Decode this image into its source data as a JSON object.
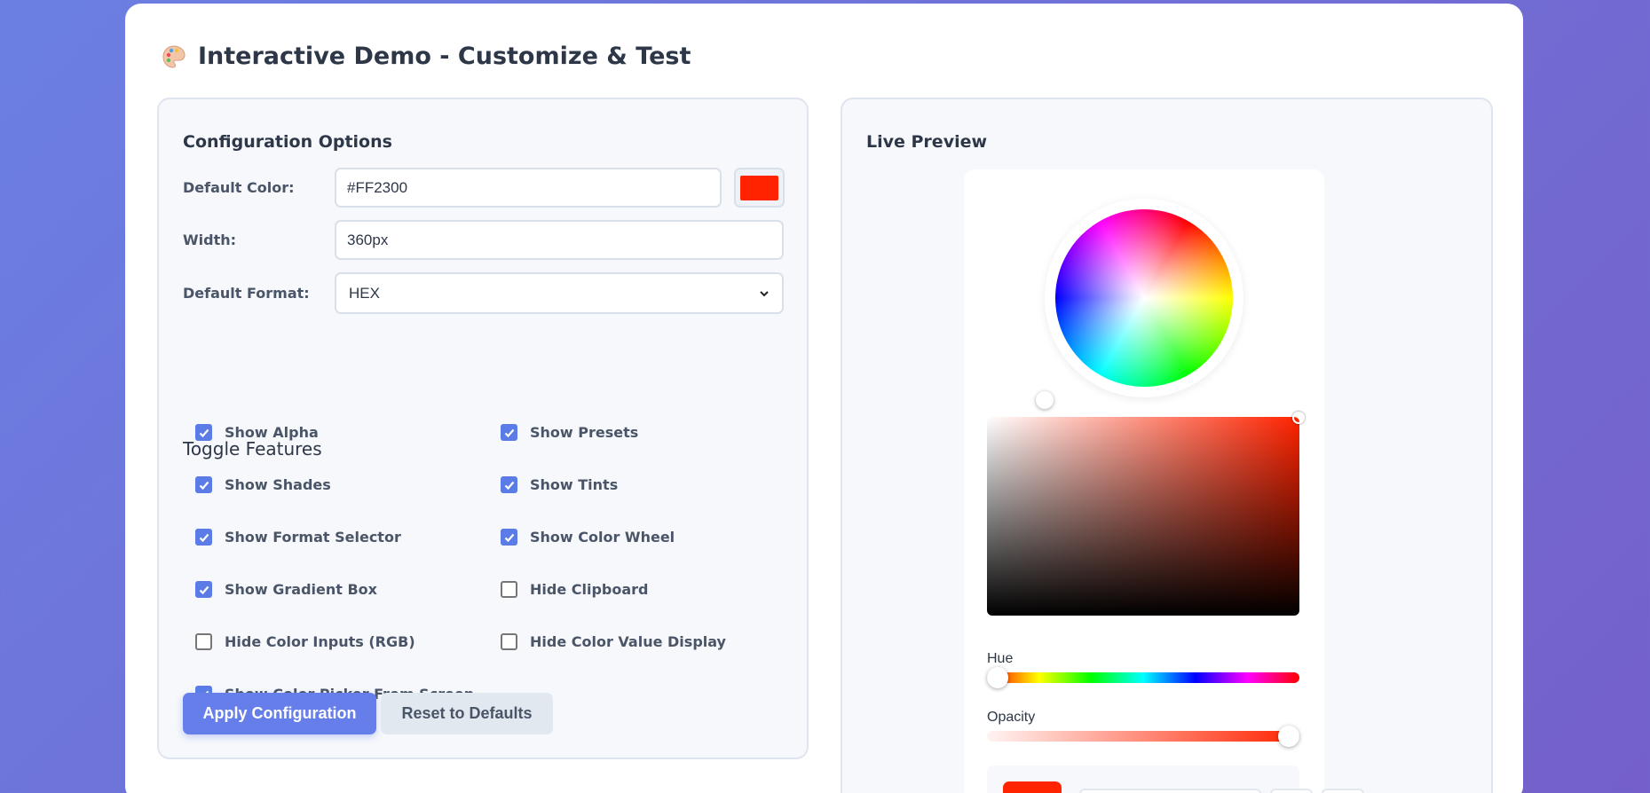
{
  "page": {
    "title": "Interactive Demo - Customize & Test",
    "title_icon": "palette-icon"
  },
  "config": {
    "heading": "Configuration Options",
    "default_color_label": "Default Color:",
    "default_color_value": "#FF2300",
    "width_label": "Width:",
    "width_value": "360px",
    "format_label": "Default Format:",
    "format_value": "HEX",
    "toggle_heading": "Toggle Features",
    "toggles": [
      {
        "label": "Show Alpha",
        "checked": true
      },
      {
        "label": "Show Presets",
        "checked": true
      },
      {
        "label": "Show Shades",
        "checked": true
      },
      {
        "label": "Show Tints",
        "checked": true
      },
      {
        "label": "Show Format Selector",
        "checked": true
      },
      {
        "label": "Show Color Wheel",
        "checked": true
      },
      {
        "label": "Show Gradient Box",
        "checked": true
      },
      {
        "label": "Hide Clipboard",
        "checked": false
      },
      {
        "label": "Hide Color Inputs (RGB)",
        "checked": false
      },
      {
        "label": "Hide Color Value Display",
        "checked": false
      },
      {
        "label": "Show Color Picker From Screen",
        "checked": true
      }
    ],
    "apply_label": "Apply Configuration",
    "reset_label": "Reset to Defaults"
  },
  "preview": {
    "heading": "Live Preview",
    "hue_label": "Hue",
    "opacity_label": "Opacity",
    "hue_value_fraction": 0.0,
    "opacity_value_fraction": 1.0,
    "current_color": "#FF2300"
  },
  "colors": {
    "accent": "#667eea",
    "selected": "#FF2300"
  }
}
